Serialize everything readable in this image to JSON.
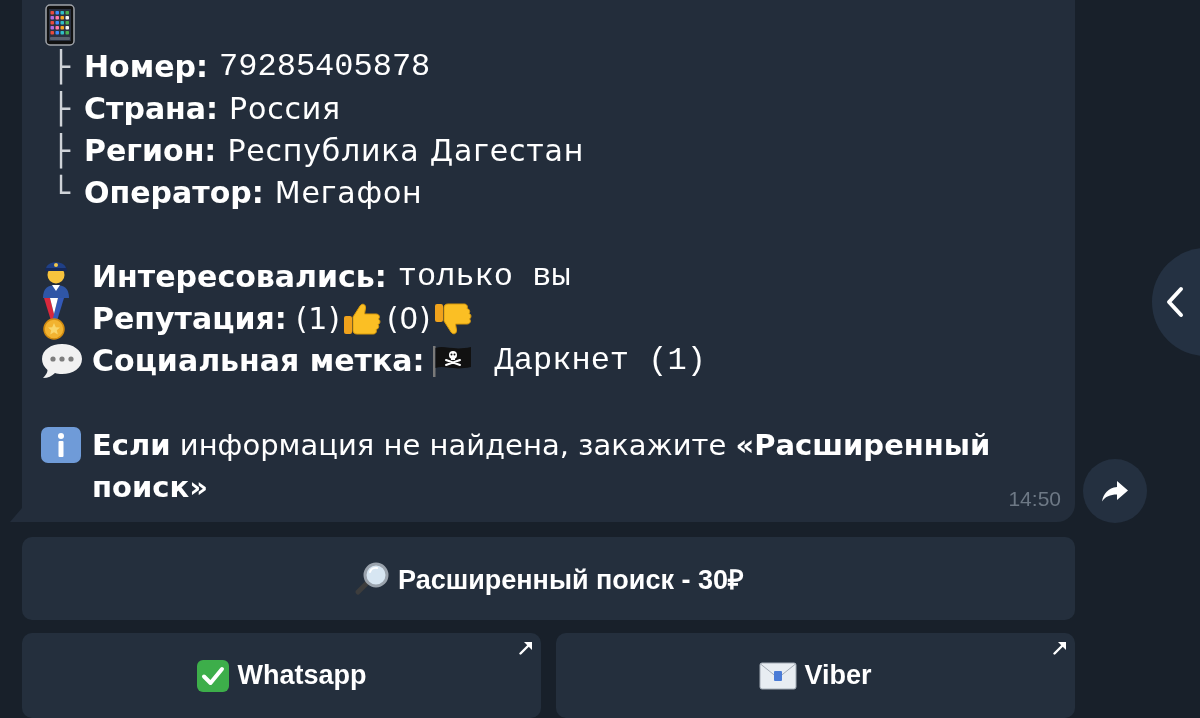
{
  "message": {
    "number_tree": [
      {
        "branch": "├",
        "label": "Номер:",
        "value": "79285405878",
        "kind": "code"
      },
      {
        "branch": "├",
        "label": "Страна:",
        "value": "Россия",
        "kind": "plain"
      },
      {
        "branch": "├",
        "label": "Регион:",
        "value": "Республика Дагестан",
        "kind": "plain"
      },
      {
        "branch": "└",
        "label": "Оператор:",
        "value": "Мегафон",
        "kind": "plain"
      }
    ],
    "details": [
      {
        "kind": "interest",
        "label": "Интересовались:",
        "value": "только вы"
      },
      {
        "kind": "reputation",
        "label": "Репутация:",
        "votes": [
          {
            "kind": "up",
            "count": "(1)"
          },
          {
            "kind": "down",
            "count": "(0)"
          }
        ]
      },
      {
        "kind": "tag",
        "label": "Социальная метка:",
        "value": "Даркнет (1)"
      }
    ],
    "notice": "**Если** информация не найдена, закажите **«Расширенный поиск»**",
    "time": "14:50"
  },
  "keyboard": {
    "rows": [
      {
        "buttons": [
          {
            "kind": "search",
            "label": "Расширенный поиск - 30₽",
            "link": false
          }
        ]
      },
      {
        "buttons": [
          {
            "kind": "check",
            "label": "Whatsapp",
            "link": true
          },
          {
            "kind": "mail",
            "label": "Viber",
            "link": true
          }
        ]
      }
    ]
  }
}
